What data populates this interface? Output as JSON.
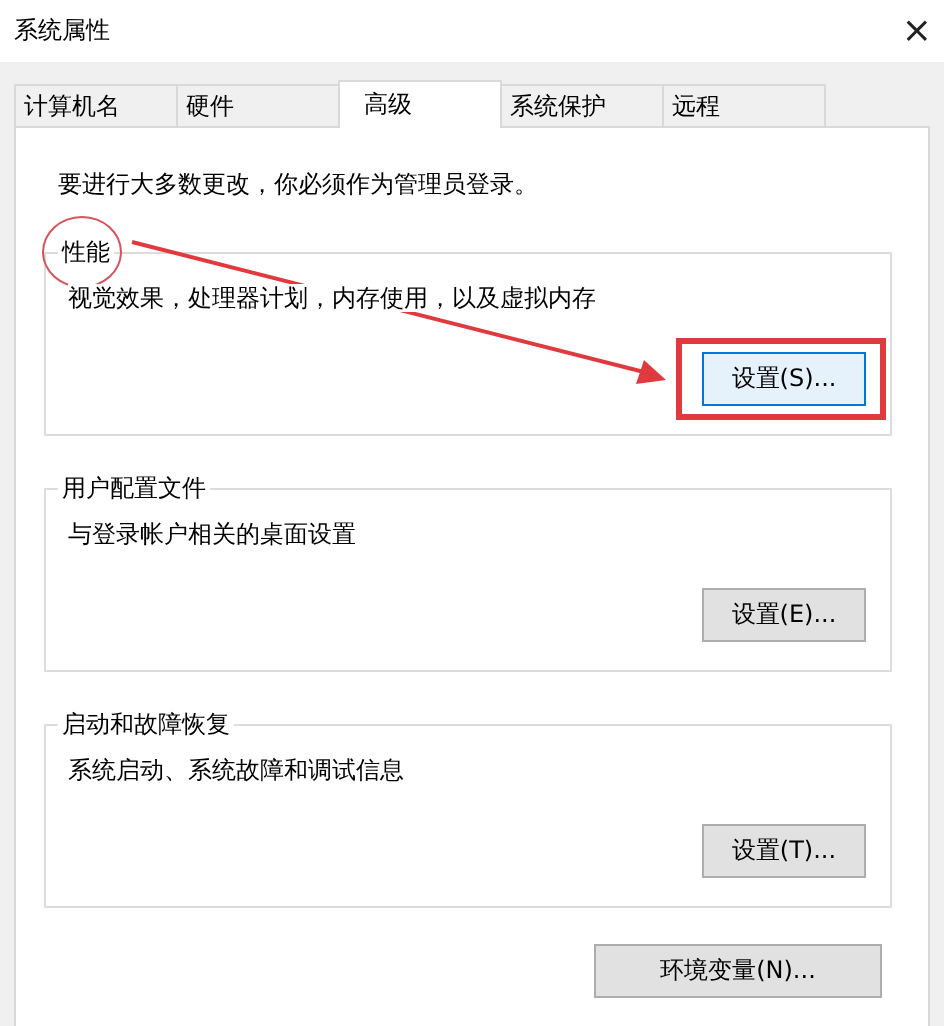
{
  "window": {
    "title": "系统属性",
    "close": "×"
  },
  "tabs": [
    {
      "label": "计算机名",
      "selected": false
    },
    {
      "label": "硬件",
      "selected": false
    },
    {
      "label": "高级",
      "selected": true
    },
    {
      "label": "系统保护",
      "selected": false
    },
    {
      "label": "远程",
      "selected": false
    }
  ],
  "notice": "要进行大多数更改，你必须作为管理员登录。",
  "groups": [
    {
      "title": "性能",
      "description": "视觉效果，处理器计划，内存使用，以及虚拟内存",
      "button": "设置(S)...",
      "highlighted": true
    },
    {
      "title": "用户配置文件",
      "description": "与登录帐户相关的桌面设置",
      "button": "设置(E)...",
      "highlighted": false
    },
    {
      "title": "启动和故障恢复",
      "description": "系统启动、系统故障和调试信息",
      "button": "设置(T)...",
      "highlighted": false
    }
  ],
  "env_button": "环境变量(N)..."
}
